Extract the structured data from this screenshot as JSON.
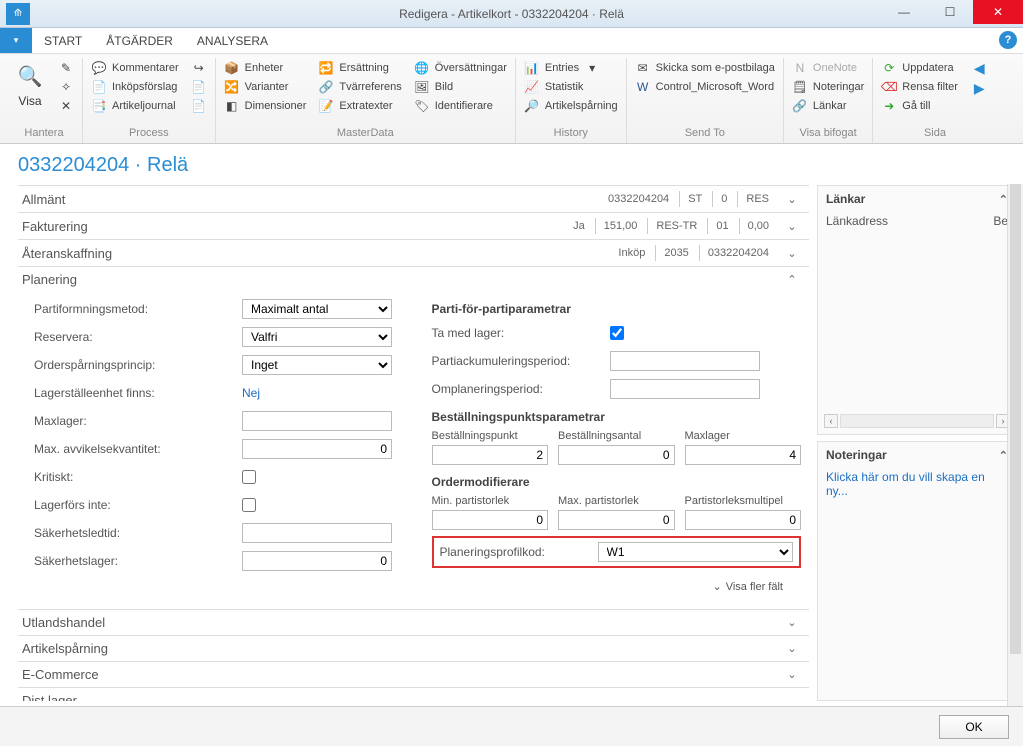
{
  "window": {
    "title": "Redigera - Artikelkort - 0332204204 · Relä"
  },
  "tabs": {
    "file_glyph": "▾",
    "start": "START",
    "atgarder": "ÅTGÄRDER",
    "analysera": "ANALYSERA"
  },
  "ribbon": {
    "hantera": {
      "label": "Hantera",
      "visa": "Visa"
    },
    "process": {
      "label": "Process",
      "kommentarer": "Kommentarer",
      "inkopsforslag": "Inköpsförslag",
      "artikeljournal": "Artikeljournal"
    },
    "masterdata": {
      "label": "MasterData",
      "enheter": "Enheter",
      "varianter": "Varianter",
      "dimensioner": "Dimensioner",
      "ersattning": "Ersättning",
      "tvarreferens": "Tvärreferens",
      "extratexter": "Extratexter",
      "oversattningar": "Översättningar",
      "bild": "Bild",
      "identifierare": "Identifierare"
    },
    "history": {
      "label": "History",
      "entries": "Entries",
      "statistik": "Statistik",
      "artikelsparning": "Artikelspårning"
    },
    "sendto": {
      "label": "Send To",
      "epost": "Skicka som e-postbilaga",
      "word": "Control_Microsoft_Word"
    },
    "visabifogat": {
      "label": "Visa bifogat",
      "onenote": "OneNote",
      "noteringar": "Noteringar",
      "lankar": "Länkar"
    },
    "sida": {
      "label": "Sida",
      "uppdatera": "Uppdatera",
      "rensa": "Rensa filter",
      "gatill": "Gå till"
    }
  },
  "page_title": "0332204204 · Relä",
  "ft": {
    "allmant": {
      "title": "Allmänt",
      "s1": "0332204204",
      "s2": "ST",
      "s3": "0",
      "s4": "RES"
    },
    "fakturering": {
      "title": "Fakturering",
      "s1": "Ja",
      "s2": "151,00",
      "s3": "RES-TR",
      "s4": "01",
      "s5": "0,00"
    },
    "ateranskaffning": {
      "title": "Återanskaffning",
      "s1": "Inköp",
      "s2": "2035",
      "s3": "0332204204"
    },
    "planering": {
      "title": "Planering"
    },
    "utlandshandel": {
      "title": "Utlandshandel"
    },
    "artikelsparning": {
      "title": "Artikelspårning"
    },
    "ecommerce": {
      "title": "E-Commerce"
    },
    "distlager": {
      "title": "Dist.lager"
    }
  },
  "plan": {
    "partiformningsmetod_l": "Partiformningsmetod:",
    "partiformningsmetod_v": "Maximalt antal",
    "reservera_l": "Reservera:",
    "reservera_v": "Valfri",
    "ordersparning_l": "Orderspårningsprincip:",
    "ordersparning_v": "Inget",
    "lagerstalleenhet_l": "Lagerställeenhet finns:",
    "lagerstalleenhet_v": "Nej",
    "maxlager_l": "Maxlager:",
    "maxlager_v": "",
    "maxavvik_l": "Max. avvikelsekvantitet:",
    "maxavvik_v": "0",
    "kritiskt_l": "Kritiskt:",
    "lagerfors_l": "Lagerförs inte:",
    "sakerhetsledtid_l": "Säkerhetsledtid:",
    "sakerhetsledtid_v": "",
    "sakerhetslager_l": "Säkerhetslager:",
    "sakerhetslager_v": "0",
    "parti_hdr": "Parti-för-partiparametrar",
    "tamedlager_l": "Ta med lager:",
    "partiackum_l": "Partiackumuleringsperiod:",
    "partiackum_v": "",
    "omplanering_l": "Omplaneringsperiod:",
    "omplanering_v": "",
    "bestpunkt_hdr": "Beställningspunktsparametrar",
    "bestpunkt_l": "Beställningspunkt",
    "bestpunkt_v": "2",
    "bestantal_l": "Beställningsantal",
    "bestantal_v": "0",
    "maxlager2_l": "Maxlager",
    "maxlager2_v": "4",
    "ordermod_hdr": "Ordermodifierare",
    "minparti_l": "Min. partistorlek",
    "minparti_v": "0",
    "maxparti_l": "Max. partistorlek",
    "maxparti_v": "0",
    "partimult_l": "Partistorleksmultipel",
    "partimult_v": "0",
    "planprofil_l": "Planeringsprofilkod:",
    "planprofil_v": "W1",
    "visafler": "Visa fler fält"
  },
  "side": {
    "lankar_title": "Länkar",
    "lankadress_l": "Länkadress",
    "lankadress_v": "Be",
    "noteringar_title": "Noteringar",
    "note_link": "Klicka här om du vill skapa en ny..."
  },
  "footer": {
    "ok": "OK"
  }
}
